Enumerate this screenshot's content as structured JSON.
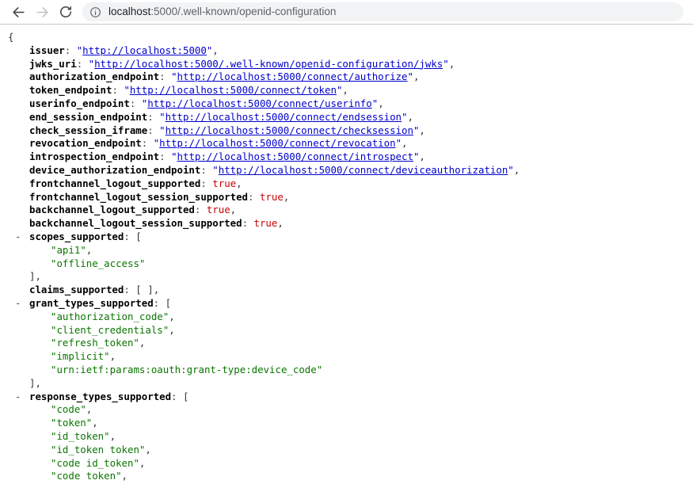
{
  "browser": {
    "back_icon": "arrow-left-icon",
    "forward_icon": "arrow-right-icon",
    "reload_icon": "reload-icon",
    "site_info_icon": "info-circle-icon",
    "url_host": "localhost",
    "url_rest": ":5000/.well-known/openid-configuration",
    "url_full": "localhost:5000/.well-known/openid-configuration",
    "colors": {
      "omnibox_bg": "#f1f3f4",
      "host_text": "#202124",
      "rest_text": "#5f6368",
      "icon": "#5f6368",
      "forward_disabled": "#bdc1c6",
      "toolbar_border": "#c9c9c9"
    }
  },
  "viewer": {
    "colors": {
      "key": "#000000",
      "url_value": "#0000cc",
      "string_value": "#0b7500",
      "boolean_value": "#cc0000",
      "punctuation": "#333333",
      "background": "#ffffff"
    },
    "open_brace": "{",
    "collapse_marker": "-",
    "close_bracket": "]",
    "comma": ",",
    "colon": ":",
    "open_bracket": "[",
    "empty_array": "[ ]",
    "quote": "\""
  },
  "json": {
    "issuer": {
      "key": "issuer",
      "value": "http://localhost:5000"
    },
    "jwks_uri": {
      "key": "jwks_uri",
      "value": "http://localhost:5000/.well-known/openid-configuration/jwks"
    },
    "authorization_endpoint": {
      "key": "authorization_endpoint",
      "value": "http://localhost:5000/connect/authorize"
    },
    "token_endpoint": {
      "key": "token_endpoint",
      "value": "http://localhost:5000/connect/token"
    },
    "userinfo_endpoint": {
      "key": "userinfo_endpoint",
      "value": "http://localhost:5000/connect/userinfo"
    },
    "end_session_endpoint": {
      "key": "end_session_endpoint",
      "value": "http://localhost:5000/connect/endsession"
    },
    "check_session_iframe": {
      "key": "check_session_iframe",
      "value": "http://localhost:5000/connect/checksession"
    },
    "revocation_endpoint": {
      "key": "revocation_endpoint",
      "value": "http://localhost:5000/connect/revocation"
    },
    "introspection_endpoint": {
      "key": "introspection_endpoint",
      "value": "http://localhost:5000/connect/introspect"
    },
    "device_authorization_endpoint": {
      "key": "device_authorization_endpoint",
      "value": "http://localhost:5000/connect/deviceauthorization"
    },
    "frontchannel_logout_supported": {
      "key": "frontchannel_logout_supported",
      "value": "true"
    },
    "frontchannel_logout_session_supported": {
      "key": "frontchannel_logout_session_supported",
      "value": "true"
    },
    "backchannel_logout_supported": {
      "key": "backchannel_logout_supported",
      "value": "true"
    },
    "backchannel_logout_session_supported": {
      "key": "backchannel_logout_session_supported",
      "value": "true"
    },
    "scopes_supported": {
      "key": "scopes_supported",
      "items": [
        "api1",
        "offline_access"
      ]
    },
    "claims_supported": {
      "key": "claims_supported",
      "items": []
    },
    "grant_types_supported": {
      "key": "grant_types_supported",
      "items": [
        "authorization_code",
        "client_credentials",
        "refresh_token",
        "implicit",
        "urn:ietf:params:oauth:grant-type:device_code"
      ]
    },
    "response_types_supported": {
      "key": "response_types_supported",
      "items": [
        "code",
        "token",
        "id_token",
        "id_token token",
        "code id_token",
        "code token"
      ]
    }
  }
}
